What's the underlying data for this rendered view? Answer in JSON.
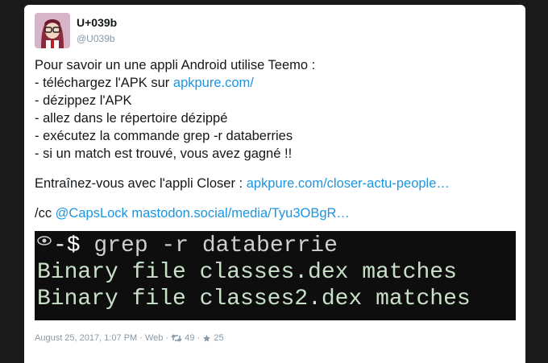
{
  "tweet": {
    "display_name": "U+039b",
    "username": "@U039b",
    "text": {
      "line1": "Pour savoir un une appli Android utilise Teemo :",
      "line2_prefix": " - téléchargez l'APK sur ",
      "line2_link": "apkpure.com/",
      "line3": " - dézippez l'APK",
      "line4": " - allez dans le répertoire dézippé",
      "line5": " - exécutez la commande grep -r databerries",
      "line6": " - si un match est trouvé, vous avez gagné !!",
      "line7_prefix": "Entraînez-vous avec l'appli Closer : ",
      "line7_link": "apkpure.com/closer-actu-people…",
      "line8_prefix": "/cc ",
      "line8_mention": "@CapsLock",
      "line8_link": "mastodon.social/media/Tyu3OBgR…"
    },
    "media": {
      "prompt": "-$",
      "command": "grep -r databerrie",
      "output1": "Binary file classes.dex matches",
      "output2": "Binary file classes2.dex matches"
    },
    "footer": {
      "date": "August 25, 2017, 1:07 PM",
      "separator": "·",
      "source": "Web",
      "retweets": "49",
      "likes": "25"
    }
  },
  "icons": {
    "retweet": "retweet-icon",
    "like": "star-icon",
    "eye": "eye-icon"
  },
  "colors": {
    "link": "#1b95e0",
    "meta": "#8899a6",
    "terminal_bg": "#0e0e0e"
  }
}
